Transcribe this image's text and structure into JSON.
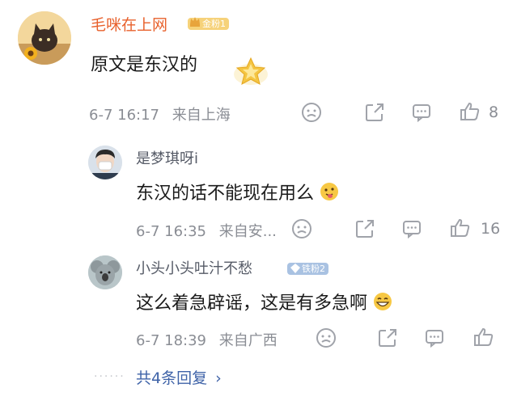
{
  "comment": {
    "author": "毛咪在上网",
    "badge": "金粉1",
    "text": "原文是东汉的",
    "time": "6-7 16:17",
    "location": "来自上海",
    "likes": "8"
  },
  "replies": [
    {
      "author": "是梦琪呀i",
      "text": "东汉的话不能现在用么",
      "time": "6-7 16:35",
      "location": "来自安...",
      "likes": "16"
    },
    {
      "author": "小头小头吐汁不愁",
      "badge": "铁粉2",
      "text": "这么着急辟谣，这是有多急啊",
      "time": "6-7 18:39",
      "location": "来自广西",
      "likes": ""
    }
  ],
  "more": {
    "label": "共4条回复",
    "chevron": "›"
  },
  "colors": {
    "username_main": "#e8612c",
    "username": "#555a66",
    "meta": "#8a8d94",
    "link": "#3f63a8",
    "icon": "#a0a3aa"
  },
  "icons": [
    "emoji-icon",
    "share-icon",
    "comment-icon",
    "like-icon",
    "star-badge-icon",
    "chevron-right-icon"
  ]
}
